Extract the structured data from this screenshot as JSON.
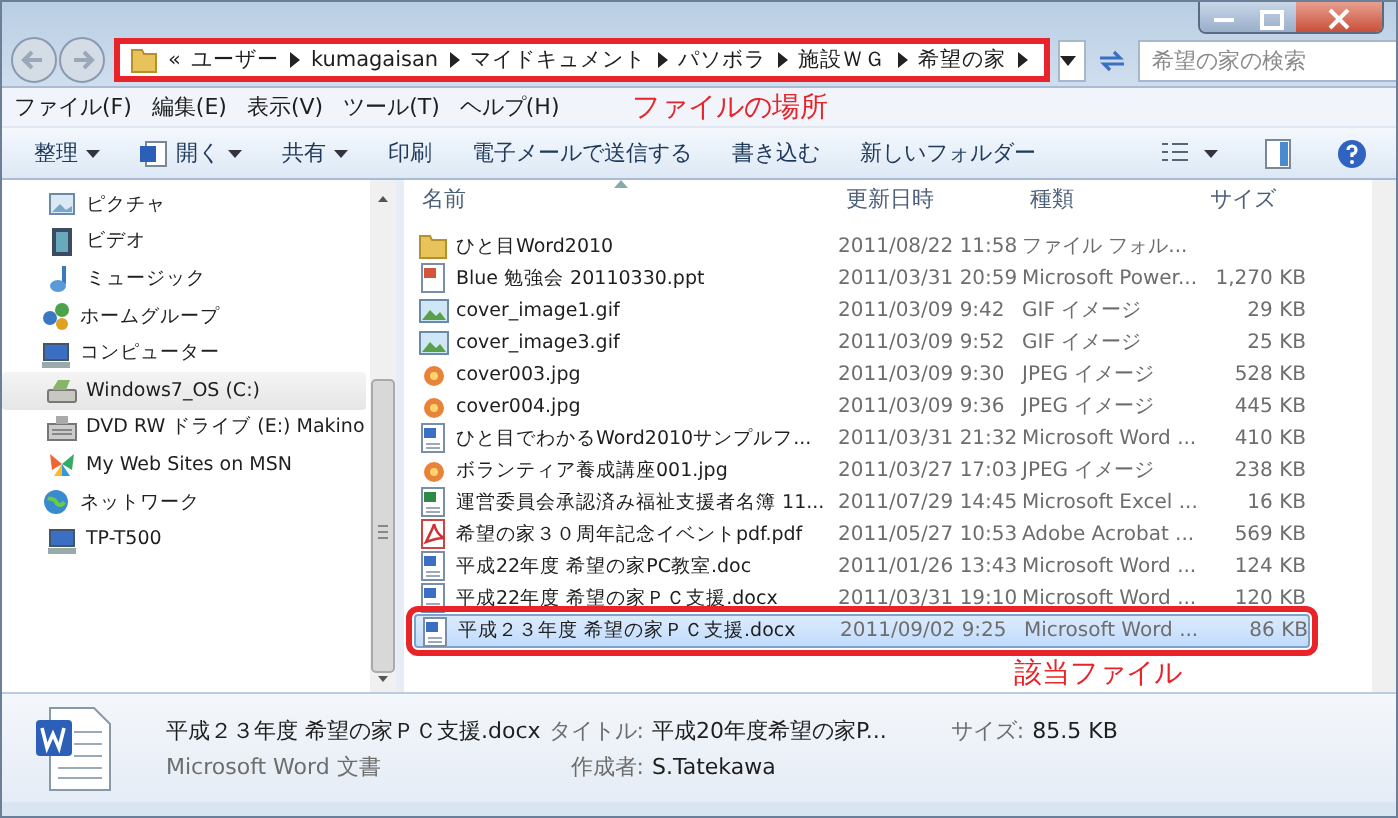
{
  "address_bar": {
    "overflow": "«",
    "crumbs": [
      "ユーザー",
      "kumagaisan",
      "マイドキュメント",
      "パソボラ",
      "施設ＷＧ",
      "希望の家"
    ],
    "outlined": true,
    "callout": "ファイルの場所"
  },
  "search": {
    "placeholder": "希望の家の検索"
  },
  "menu": [
    "ファイル(F)",
    "編集(E)",
    "表示(V)",
    "ツール(T)",
    "ヘルプ(H)"
  ],
  "toolbar": [
    {
      "label": "整理",
      "dropdown": true,
      "kind": "plain"
    },
    {
      "label": "開く",
      "dropdown": true,
      "kind": "word"
    },
    {
      "label": "共有",
      "dropdown": true,
      "kind": "plain"
    },
    {
      "label": "印刷",
      "dropdown": false,
      "kind": "plain"
    },
    {
      "label": "電子メールで送信する",
      "dropdown": false,
      "kind": "plain"
    },
    {
      "label": "書き込む",
      "dropdown": false,
      "kind": "plain"
    },
    {
      "label": "新しいフォルダー",
      "dropdown": false,
      "kind": "plain"
    }
  ],
  "sidebar": {
    "sections": [
      {
        "children": [
          {
            "label": "ピクチャ",
            "kind": "pictures",
            "selected": false
          },
          {
            "label": "ビデオ",
            "kind": "video",
            "selected": false
          },
          {
            "label": "ミュージック",
            "kind": "music",
            "selected": false
          }
        ]
      },
      {
        "label": "ホームグループ",
        "kind": "homegroup",
        "selected": false
      },
      {
        "label": "コンピューター",
        "kind": "computer",
        "selected": false,
        "children": [
          {
            "label": "Windows7_OS (C:)",
            "kind": "disk",
            "selected": true
          },
          {
            "label": "DVD RW ドライブ (E:) Makino",
            "kind": "dvd",
            "selected": false
          },
          {
            "label": "My Web Sites on MSN",
            "kind": "msn",
            "selected": false
          }
        ]
      },
      {
        "label": "ネットワーク",
        "kind": "network",
        "selected": false,
        "children": [
          {
            "label": "TP-T500",
            "kind": "computer",
            "selected": false
          }
        ]
      }
    ]
  },
  "table": {
    "columns": [
      {
        "label": "名前",
        "sorted": true
      },
      {
        "label": "更新日時",
        "sorted": false
      },
      {
        "label": "種類",
        "sorted": false
      },
      {
        "label": "サイズ",
        "sorted": false
      }
    ],
    "rows": [
      {
        "name": "ひと目Word2010",
        "date": "2011/08/22 11:58",
        "type": "ファイル フォル...",
        "size": "",
        "kind": "folder",
        "selected": false,
        "outlined": false
      },
      {
        "name": "Blue 勉強会 20110330.ppt",
        "date": "2011/03/31 20:59",
        "type": "Microsoft Power...",
        "size": "1,270 KB",
        "kind": "ppt",
        "selected": false,
        "outlined": false
      },
      {
        "name": "cover_image1.gif",
        "date": "2011/03/09 9:42",
        "type": "GIF イメージ",
        "size": "29 KB",
        "kind": "gif",
        "selected": false,
        "outlined": false
      },
      {
        "name": "cover_image3.gif",
        "date": "2011/03/09 9:52",
        "type": "GIF イメージ",
        "size": "25 KB",
        "kind": "gif",
        "selected": false,
        "outlined": false
      },
      {
        "name": "cover003.jpg",
        "date": "2011/03/09 9:30",
        "type": "JPEG イメージ",
        "size": "528 KB",
        "kind": "jpg",
        "selected": false,
        "outlined": false
      },
      {
        "name": "cover004.jpg",
        "date": "2011/03/09 9:36",
        "type": "JPEG イメージ",
        "size": "445 KB",
        "kind": "jpg",
        "selected": false,
        "outlined": false
      },
      {
        "name": "ひと目でわかるWord2010サンプルフ...",
        "date": "2011/03/31 21:32",
        "type": "Microsoft Word ...",
        "size": "410 KB",
        "kind": "word",
        "selected": false,
        "outlined": false
      },
      {
        "name": "ボランティア養成講座001.jpg",
        "date": "2011/03/27 17:03",
        "type": "JPEG イメージ",
        "size": "238 KB",
        "kind": "jpg",
        "selected": false,
        "outlined": false
      },
      {
        "name": "運営委員会承認済み福祉支援者名簿 11...",
        "date": "2011/07/29 14:45",
        "type": "Microsoft Excel ...",
        "size": "16 KB",
        "kind": "excel",
        "selected": false,
        "outlined": false
      },
      {
        "name": "希望の家３０周年記念イベントpdf.pdf",
        "date": "2011/05/27 10:53",
        "type": "Adobe Acrobat ...",
        "size": "569 KB",
        "kind": "pdf",
        "selected": false,
        "outlined": false
      },
      {
        "name": "平成22年度 希望の家PC教室.doc",
        "date": "2011/01/26 13:43",
        "type": "Microsoft Word ...",
        "size": "124 KB",
        "kind": "word",
        "selected": false,
        "outlined": false
      },
      {
        "name": "平成22年度 希望の家ＰＣ支援.docx",
        "date": "2011/03/31 19:10",
        "type": "Microsoft Word ...",
        "size": "120 KB",
        "kind": "word",
        "selected": false,
        "outlined": false
      },
      {
        "name": "平成２３年度 希望の家ＰＣ支援.docx",
        "date": "2011/09/02 9:25",
        "type": "Microsoft Word ...",
        "size": "86 KB",
        "kind": "word",
        "selected": true,
        "outlined": true,
        "callout": "該当ファイル"
      }
    ]
  },
  "details": {
    "name": "平成２３年度 希望の家ＰＣ支援.docx",
    "type": "Microsoft Word 文書",
    "fields": [
      {
        "label": "タイトル:",
        "value": "平成20年度希望の家P..."
      },
      {
        "label": "サイズ:",
        "value": "85.5 KB"
      },
      {
        "label": "作成者:",
        "value": "S.Tatekawa"
      }
    ]
  }
}
